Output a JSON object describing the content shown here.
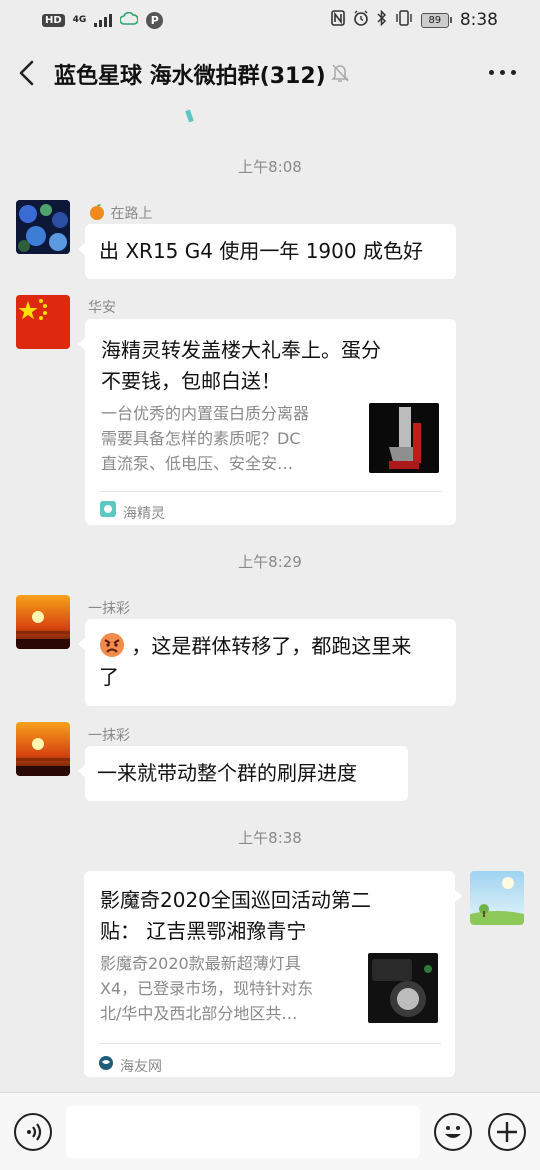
{
  "status_bar": {
    "hd": "HD",
    "net_top": "4G",
    "net_bottom": "1l",
    "p_badge": "P",
    "nfc": "N",
    "battery": "89",
    "time": "8:38"
  },
  "header": {
    "title": "蓝色星球 海水微拍群(312)"
  },
  "messages": {
    "t1": "上午8:08",
    "m1": {
      "sender": "在路上",
      "text": "出 XR15 G4 使用一年 1900 成色好"
    },
    "m2": {
      "sender": "华安",
      "card_title_1": "海精灵转发盖楼大礼奉上。蛋分",
      "card_title_2": "不要钱，包邮白送！",
      "desc_1": "一台优秀的内置蛋白质分离器",
      "desc_2": "需要具备怎样的素质呢？DC",
      "desc_3": "直流泵、低电压、安全安…",
      "source": "海精灵"
    },
    "t2": "上午8:29",
    "m3": {
      "sender": "一抹彩",
      "text_1": "，这是群体转移了，都跑这里来",
      "text_2": "了"
    },
    "m4": {
      "sender": "一抹彩",
      "text": "一来就带动整个群的刷屏进度"
    },
    "t3": "上午8:38",
    "m5": {
      "card_title_1": "影魔奇2020全国巡回活动第二",
      "card_title_2": "贴：  辽吉黑鄂湘豫青宁",
      "desc_1": "影魔奇2020款最新超薄灯具",
      "desc_2": "X4，已登录市场，现特针对东",
      "desc_3": "北/华中及西北部分地区共…",
      "source": "海友网"
    }
  },
  "input": {
    "placeholder": ""
  },
  "colors": {
    "background": "#ededed",
    "bubble": "#ffffff",
    "meta_text": "#8a8a8a"
  }
}
